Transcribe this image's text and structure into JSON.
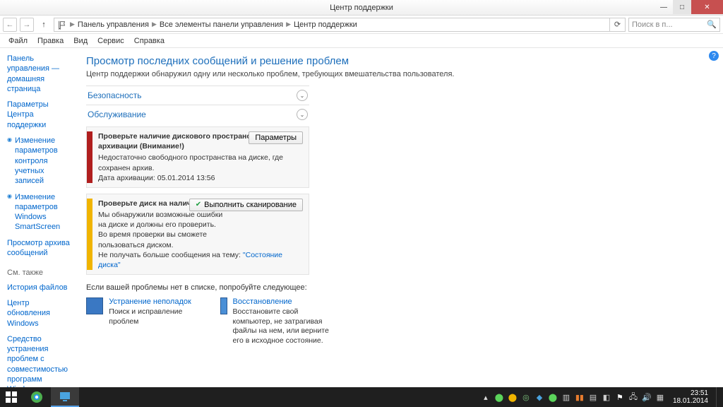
{
  "window": {
    "title": "Центр поддержки"
  },
  "breadcrumb": {
    "b1": "Панель управления",
    "b2": "Все элементы панели управления",
    "b3": "Центр поддержки"
  },
  "search": {
    "placeholder": "Поиск в п..."
  },
  "menu": {
    "file": "Файл",
    "edit": "Правка",
    "view": "Вид",
    "service": "Сервис",
    "help": "Справка"
  },
  "sidebar": {
    "home": "Панель управления — домашняя страница",
    "params": "Параметры Центра поддержки",
    "uac": "Изменение параметров контроля учетных записей",
    "smartscreen": "Изменение параметров Windows SmartScreen",
    "archive": "Просмотр архива сообщений",
    "seealso_hdr": "См. также",
    "filehist": "История файлов",
    "winupdate": "Центр обновления Windows",
    "compat": "Средство устранения проблем с совместимостью программ Windows"
  },
  "page": {
    "title": "Просмотр последних сообщений и решение проблем",
    "subtitle": "Центр поддержки обнаружил одну или несколько проблем, требующих вмешательства пользователя."
  },
  "sections": {
    "security": "Безопасность",
    "maintenance": "Обслуживание"
  },
  "msg1": {
    "title": "Проверьте наличие дискового пространства для архивации  (Внимание!)",
    "line1": "Недостаточно свободного пространства на диске, где сохранен архив.",
    "line2": "Дата архивации: 05.01.2014 13:56",
    "button": "Параметры"
  },
  "msg2": {
    "title": "Проверьте диск на наличие ошибок",
    "body": "Мы обнаружили возможные ошибки на диске и должны его проверить. Во время проверки вы сможете пользоваться диском.",
    "mute_prefix": "Не получать больше сообщения на тему: ",
    "mute_link": "\"Состояние диска\"",
    "button": "Выполнить сканирование"
  },
  "try": {
    "text": "Если вашей проблемы нет в списке, попробуйте следующее:"
  },
  "tool1": {
    "title": "Устранение неполадок",
    "desc": "Поиск и исправление проблем"
  },
  "tool2": {
    "title": "Восстановление",
    "desc": "Восстановите свой компьютер, не затрагивая файлы на нем, или верните его в исходное состояние."
  },
  "clock": {
    "time": "23:51",
    "date": "18.01.2014"
  }
}
